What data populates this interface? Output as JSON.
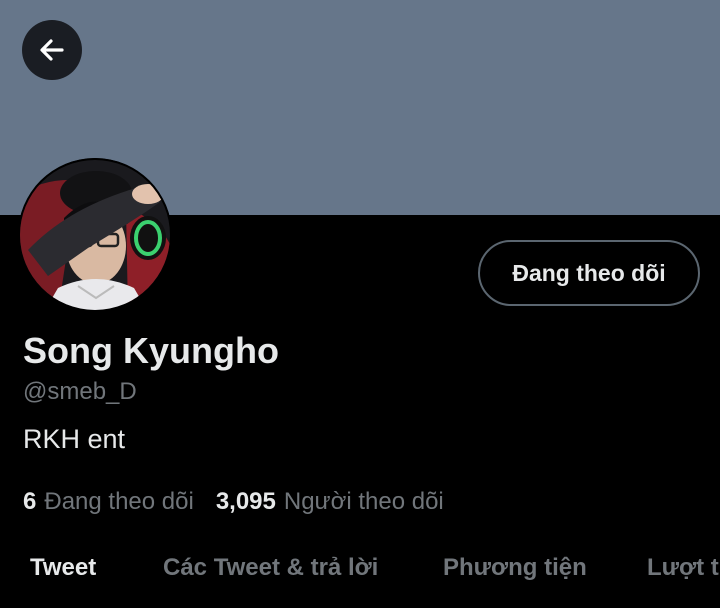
{
  "header": {
    "back_icon": "arrow-left-icon",
    "banner_color": "#66768a"
  },
  "profile": {
    "avatar_icon": "profile-photo",
    "display_name": "Song Kyungho",
    "handle": "@smeb_D",
    "bio": "RKH ent",
    "follow_button_label": "Đang theo dõi"
  },
  "stats": {
    "following_count": "6",
    "following_label": "Đang theo dõi",
    "followers_count": "3,095",
    "followers_label": "Người theo dõi"
  },
  "tabs": [
    {
      "label": "Tweet",
      "active": true
    },
    {
      "label": "Các Tweet & trả lời",
      "active": false
    },
    {
      "label": "Phương tiện",
      "active": false
    },
    {
      "label": "Lượt thích",
      "active": false
    }
  ],
  "colors": {
    "accent": "#1d9bf0",
    "text_primary": "#e7e9ea",
    "text_secondary": "#71767b",
    "background": "#000000"
  }
}
